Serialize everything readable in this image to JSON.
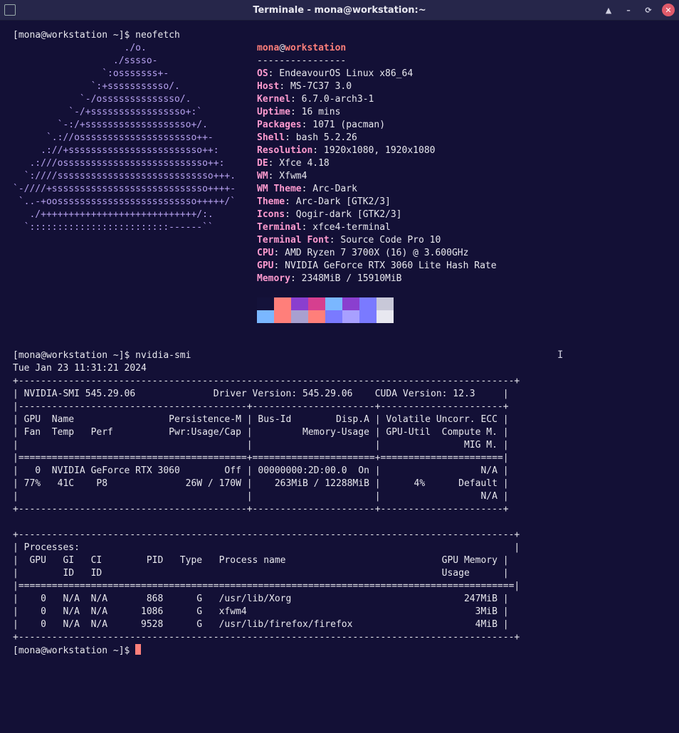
{
  "window": {
    "title": "Terminale - mona@workstation:~",
    "buttons": [
      "▲",
      "–",
      "⟳",
      "✕"
    ]
  },
  "neofetch": {
    "prompt": "[mona@workstation ~]$ neofetch",
    "logo_lines": [
      "                    ./o.",
      "                  ./sssso-",
      "                `:osssssss+-",
      "              `:+sssssssssso/.",
      "            `-/ossssssssssssso/.",
      "          `-/+sssssssssssssssso+:`",
      "        `-:/+sssssssssssssssssso+/.",
      "      `.://osssssssssssssssssssso++-",
      "     .://+ssssssssssssssssssssssso++:",
      "   .:///ossssssssssssssssssssssssso++:",
      "  `:////ssssssssssssssssssssssssssso+++.",
      "`-////+ssssssssssssssssssssssssssso++++-",
      " `..-+oosssssssssssssssssssssssso+++++/`",
      "   ./++++++++++++++++++++++++++++/:.",
      "  `:::::::::::::::::::::::::------``"
    ],
    "user": "mona",
    "host": "workstation",
    "separator": "----------------",
    "info": [
      {
        "label": "OS",
        "value": "EndeavourOS Linux x86_64"
      },
      {
        "label": "Host",
        "value": "MS-7C37 3.0"
      },
      {
        "label": "Kernel",
        "value": "6.7.0-arch3-1"
      },
      {
        "label": "Uptime",
        "value": "16 mins"
      },
      {
        "label": "Packages",
        "value": "1071 (pacman)"
      },
      {
        "label": "Shell",
        "value": "bash 5.2.26"
      },
      {
        "label": "Resolution",
        "value": "1920x1080, 1920x1080"
      },
      {
        "label": "DE",
        "value": "Xfce 4.18"
      },
      {
        "label": "WM",
        "value": "Xfwm4"
      },
      {
        "label": "WM Theme",
        "value": "Arc-Dark"
      },
      {
        "label": "Theme",
        "value": "Arc-Dark [GTK2/3]"
      },
      {
        "label": "Icons",
        "value": "Qogir-dark [GTK2/3]"
      },
      {
        "label": "Terminal",
        "value": "xfce4-terminal"
      },
      {
        "label": "Terminal Font",
        "value": "Source Code Pro 10"
      },
      {
        "label": "CPU",
        "value": "AMD Ryzen 7 3700X (16) @ 3.600GHz"
      },
      {
        "label": "GPU",
        "value": "NVIDIA GeForce RTX 3060 Lite Hash Rate"
      },
      {
        "label": "Memory",
        "value": "2348MiB / 15910MiB"
      }
    ],
    "palette_top": [
      "#14123a",
      "#ff7f7a",
      "#8a3fcf",
      "#d63f8f",
      "#7ab7ff",
      "#8a3fcf",
      "#7a7aff",
      "#c8c8d8"
    ],
    "palette_bottom": [
      "#7ab7ff",
      "#ff7f7a",
      "#a8a0d0",
      "#ff7f7a",
      "#7a7aff",
      "#a8a0ff",
      "#7a7aff",
      "#e8e8f0"
    ]
  },
  "nvidia": {
    "prompt": "[mona@workstation ~]$ nvidia-smi",
    "date": "Tue Jan 23 11:31:21 2024",
    "lines": [
      "+-----------------------------------------------------------------------------------------+",
      "| NVIDIA-SMI 545.29.06              Driver Version: 545.29.06    CUDA Version: 12.3     |",
      "|-----------------------------------------+----------------------+----------------------+",
      "| GPU  Name                 Persistence-M | Bus-Id        Disp.A | Volatile Uncorr. ECC |",
      "| Fan  Temp   Perf          Pwr:Usage/Cap |         Memory-Usage | GPU-Util  Compute M. |",
      "|                                         |                      |               MIG M. |",
      "|=========================================+======================+======================|",
      "|   0  NVIDIA GeForce RTX 3060        Off | 00000000:2D:00.0  On |                  N/A |",
      "| 77%   41C    P8              26W / 170W |    263MiB / 12288MiB |      4%      Default |",
      "|                                         |                      |                  N/A |",
      "+-----------------------------------------+----------------------+----------------------+",
      "",
      "+-----------------------------------------------------------------------------------------+",
      "| Processes:                                                                              |",
      "|  GPU   GI   CI        PID   Type   Process name                            GPU Memory |",
      "|        ID   ID                                                             Usage      |",
      "|=========================================================================================|",
      "|    0   N/A  N/A       868      G   /usr/lib/Xorg                               247MiB |",
      "|    0   N/A  N/A      1086      G   xfwm4                                         3MiB |",
      "|    0   N/A  N/A      9528      G   /usr/lib/firefox/firefox                      4MiB |",
      "+-----------------------------------------------------------------------------------------+"
    ],
    "final_prompt": "[mona@workstation ~]$ "
  }
}
